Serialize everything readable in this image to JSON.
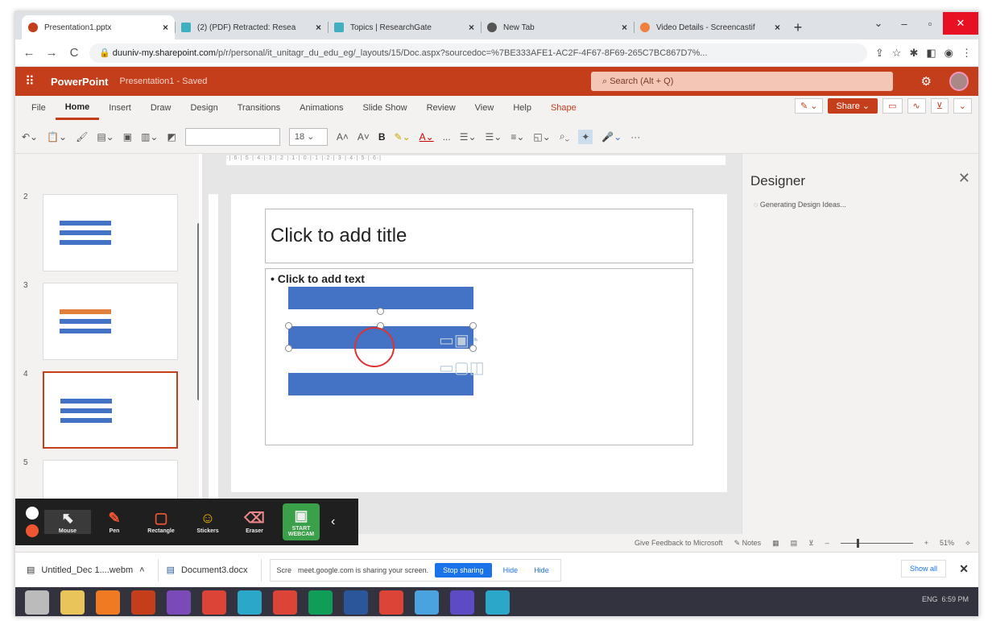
{
  "tabs": [
    {
      "title": "Presentation1.pptx",
      "color": "#c43e1c",
      "active": true
    },
    {
      "title": "(2) (PDF) Retracted: Resea",
      "color": "#40b0c0"
    },
    {
      "title": "Topics | ResearchGate",
      "color": "#40b0c0"
    },
    {
      "title": "New Tab",
      "color": "#555555"
    },
    {
      "title": "Video Details - Screencastif",
      "color": "#f08040"
    }
  ],
  "url": {
    "host": "duuniv-my.sharepoint.com",
    "path": "/p/r/personal/it_unitagr_du_edu_eg/_layouts/15/Doc.aspx?sourcedoc=%7BE333AFE1-AC2F-4F67-8F69-265C7BC867D7%..."
  },
  "header": {
    "app": "PowerPoint",
    "doc": "Presentation1 - Saved",
    "search": "Search (Alt + Q)"
  },
  "ribbon_tabs": [
    "File",
    "Home",
    "Insert",
    "Draw",
    "Design",
    "Transitions",
    "Animations",
    "Slide Show",
    "Review",
    "View",
    "Help",
    "Shape"
  ],
  "ribbon_right": {
    "share": "Share"
  },
  "toolbar": {
    "font_size": "18",
    "bold": "B",
    "more": "..."
  },
  "thumbs": [
    {
      "num": "2"
    },
    {
      "num": "3"
    },
    {
      "num": "4"
    },
    {
      "num": "5"
    }
  ],
  "slide": {
    "title": "Click to add title",
    "body": "• Click to add text"
  },
  "designer": {
    "title": "Designer",
    "status": "Generating Design Ideas..."
  },
  "statusbar": {
    "feedback": "Give Feedback to Microsoft",
    "notes": "Notes",
    "zoom": "51%"
  },
  "zoom_toolbar": {
    "items": [
      "Mouse",
      "Pen",
      "Rectangle",
      "Stickers",
      "Eraser",
      "START WEBCAM"
    ]
  },
  "downloads": {
    "item1": "Untitled_Dec 1....webm",
    "item2": "Document3.docx",
    "screen_prefix": "Scre",
    "sharing": "meet.google.com is sharing your screen.",
    "stop": "Stop sharing",
    "hide": "Hide",
    "hide2": "Hide",
    "show_all": "Show all"
  },
  "taskbar": {
    "lang": "ENG",
    "time": "6:59 PM"
  }
}
